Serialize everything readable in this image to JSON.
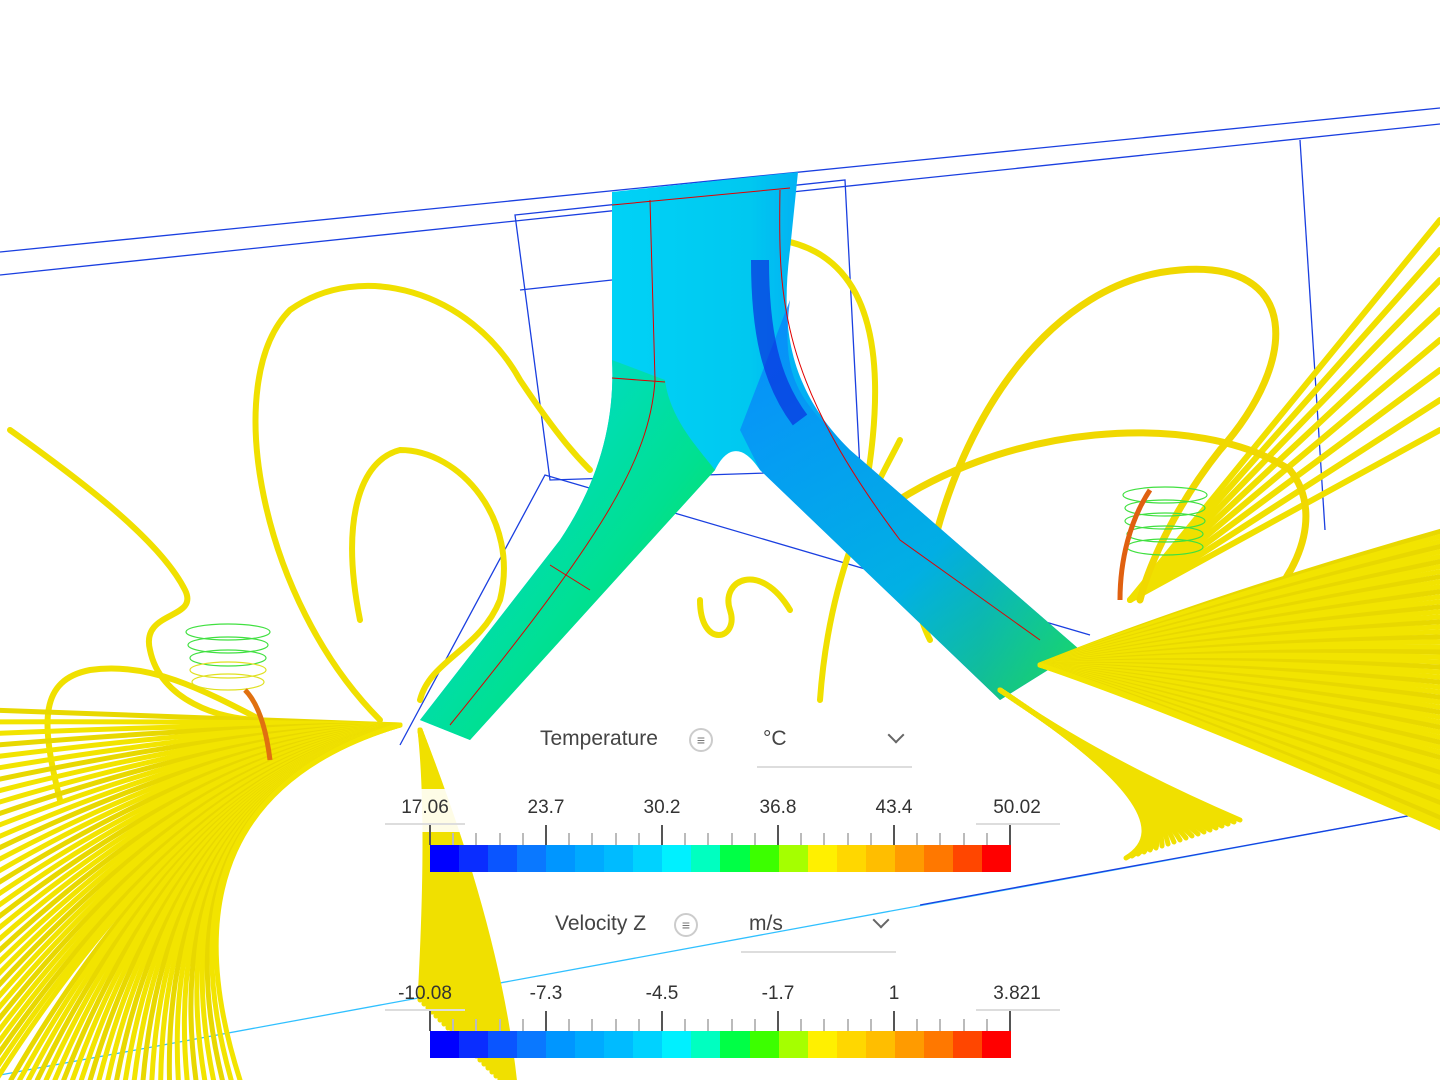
{
  "legends": [
    {
      "quantity": "Temperature",
      "unit": "°C",
      "labels": [
        "17.06",
        "23.7",
        "30.2",
        "36.8",
        "43.4",
        "50.02"
      ],
      "min": 17.06,
      "max": 50.02
    },
    {
      "quantity": "Velocity Z",
      "unit": "m/s",
      "labels": [
        "-10.08",
        "-7.3",
        "-4.5",
        "-1.7",
        "1",
        "3.821"
      ],
      "min": -10.08,
      "max": 3.821
    }
  ],
  "colormap": [
    "#0000ff",
    "#0a2dff",
    "#0a55ff",
    "#0a78ff",
    "#0096ff",
    "#00aaff",
    "#00bbff",
    "#00d2ff",
    "#00f0ff",
    "#00ffc0",
    "#00ff46",
    "#3cff00",
    "#a5ff00",
    "#fff000",
    "#ffd700",
    "#ffbe00",
    "#ff9b00",
    "#ff7800",
    "#ff4600",
    "#ff0000"
  ],
  "icons": {
    "menu": "menu-lines-icon",
    "dropdown": "chevron-down-icon"
  }
}
